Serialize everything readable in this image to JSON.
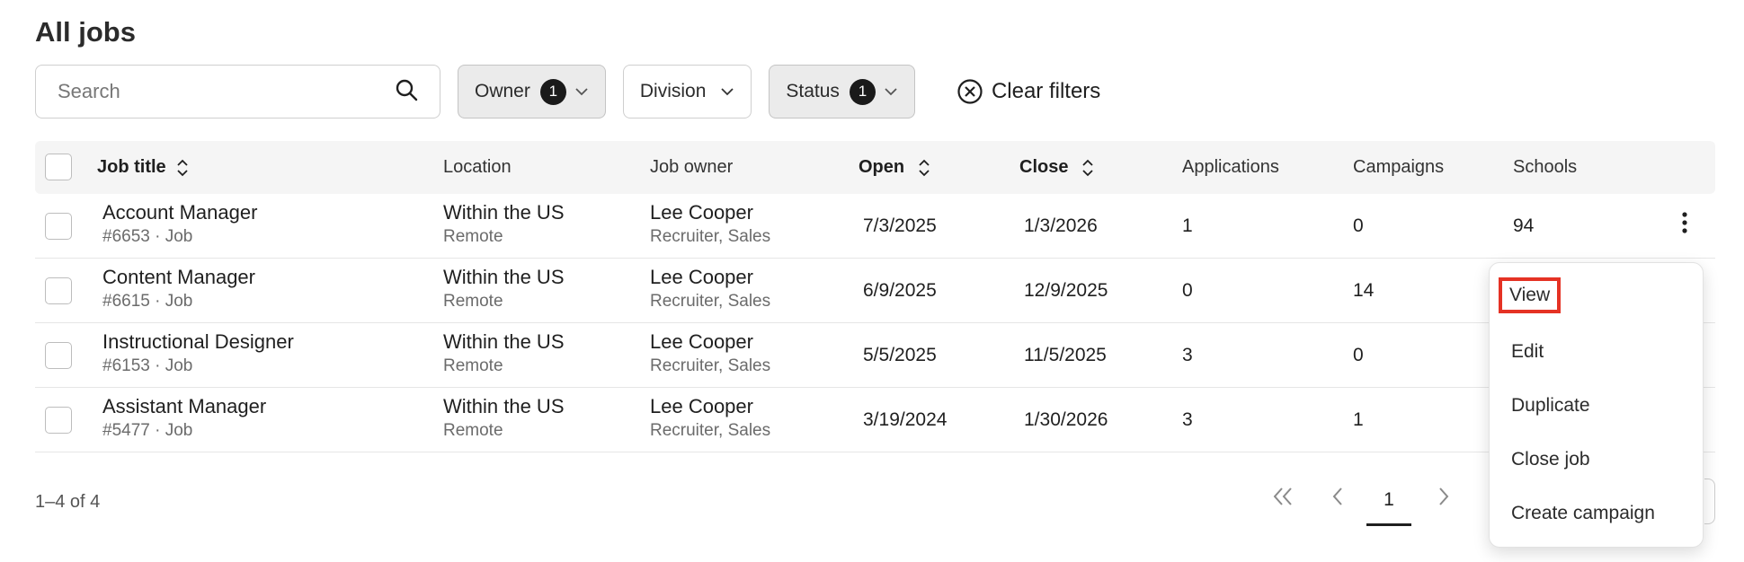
{
  "page": {
    "title": "All jobs"
  },
  "filters": {
    "search_placeholder": "Search",
    "owner": {
      "label": "Owner",
      "count": "1"
    },
    "division": {
      "label": "Division"
    },
    "status": {
      "label": "Status",
      "count": "1"
    },
    "clear_label": "Clear filters"
  },
  "table": {
    "headers": {
      "job_title": "Job title",
      "location": "Location",
      "job_owner": "Job owner",
      "open": "Open",
      "close": "Close",
      "applications": "Applications",
      "campaigns": "Campaigns",
      "schools": "Schools"
    },
    "rows": [
      {
        "title": "Account Manager",
        "meta": "#6653 · Job",
        "location": "Within the US",
        "location_sub": "Remote",
        "owner": "Lee Cooper",
        "owner_sub": "Recruiter, Sales",
        "open": "7/3/2025",
        "close": "1/3/2026",
        "applications": "1",
        "campaigns": "0",
        "schools": "94"
      },
      {
        "title": "Content Manager",
        "meta": "#6615 · Job",
        "location": "Within the US",
        "location_sub": "Remote",
        "owner": "Lee Cooper",
        "owner_sub": "Recruiter, Sales",
        "open": "6/9/2025",
        "close": "12/9/2025",
        "applications": "0",
        "campaigns": "14",
        "schools": ""
      },
      {
        "title": "Instructional Designer",
        "meta": "#6153 · Job",
        "location": "Within the US",
        "location_sub": "Remote",
        "owner": "Lee Cooper",
        "owner_sub": "Recruiter, Sales",
        "open": "5/5/2025",
        "close": "11/5/2025",
        "applications": "3",
        "campaigns": "0",
        "schools": ""
      },
      {
        "title": "Assistant Manager",
        "meta": "#5477 · Job",
        "location": "Within the US",
        "location_sub": "Remote",
        "owner": "Lee Cooper",
        "owner_sub": "Recruiter, Sales",
        "open": "3/19/2024",
        "close": "1/30/2026",
        "applications": "3",
        "campaigns": "1",
        "schools": ""
      }
    ]
  },
  "footer": {
    "range": "1–4 of 4",
    "current_page": "1"
  },
  "context_menu": {
    "items": [
      "View",
      "Edit",
      "Duplicate",
      "Close job",
      "Create campaign"
    ],
    "highlighted": "View",
    "highlight_color": "#e53224"
  },
  "icons": {
    "search": "search-icon",
    "chevron": "chevron-down-icon",
    "clear": "circle-x-icon",
    "sort": "sort-icon",
    "kebab": "kebab-menu-icon",
    "first": "chevrons-left-icon",
    "prev": "chevron-left-icon",
    "next": "chevron-right-icon"
  }
}
